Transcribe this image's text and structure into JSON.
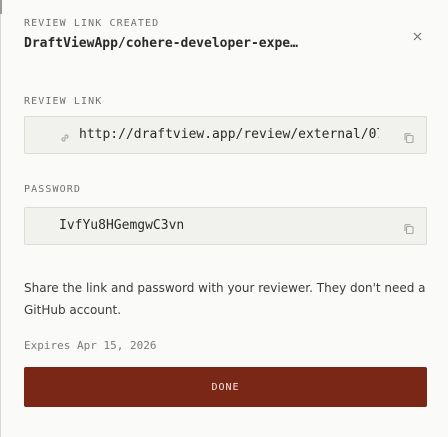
{
  "header": {
    "eyebrow": "REVIEW LINK CREATED",
    "title": "DraftViewApp/cohere-developer-expe…",
    "close_icon": "close-icon"
  },
  "review_link": {
    "label": "REVIEW LINK",
    "value": "http://draftview.app/review/external/07…",
    "leading_icon": "link-icon",
    "copy_icon": "copy-icon"
  },
  "password": {
    "label": "PASSWORD",
    "value": "IvfYu8HGemgwC3vn",
    "copy_icon": "copy-icon"
  },
  "description": "Share the link and password with your reviewer. They don't need a GitHub account.",
  "expires": "Expires Apr 15, 2026",
  "done_label": "DONE",
  "colors": {
    "accent": "#7a2716",
    "background": "#fafaf8",
    "field_bg": "#f1f1ee"
  }
}
